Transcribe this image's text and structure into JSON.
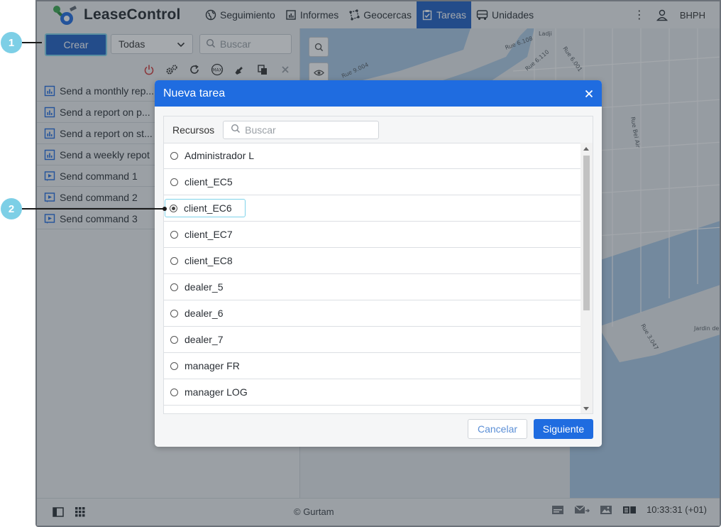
{
  "app": {
    "brand": "LeaseControl",
    "nav": [
      {
        "label": "Seguimiento",
        "icon": "globe-icon"
      },
      {
        "label": "Informes",
        "icon": "report-icon"
      },
      {
        "label": "Geocercas",
        "icon": "geofence-icon"
      },
      {
        "label": "Tareas",
        "icon": "task-icon",
        "active": true
      },
      {
        "label": "Unidades",
        "icon": "bus-icon"
      }
    ],
    "more_label": "⋮",
    "user": "BHPH",
    "accent": "#1f5fc3"
  },
  "left": {
    "create_label": "Crear",
    "filter_value": "Todas",
    "search_placeholder": "Buscar",
    "toolbar_icons": [
      "power-icon",
      "gears-icon",
      "refresh-icon",
      "max-icon",
      "wrench-icon",
      "copy-icon",
      "close-icon"
    ],
    "tasks": [
      {
        "label": "Send a monthly rep...",
        "icon": "report-icon"
      },
      {
        "label": "Send a report on p...",
        "icon": "report-icon"
      },
      {
        "label": "Send a report on st...",
        "icon": "report-icon"
      },
      {
        "label": "Send a weekly repot",
        "icon": "report-icon"
      },
      {
        "label": "Send command 1",
        "icon": "command-icon"
      },
      {
        "label": "Send command 2",
        "icon": "command-icon"
      },
      {
        "label": "Send command 3",
        "icon": "command-icon"
      }
    ]
  },
  "map": {
    "labels": [
      "Ladji",
      "Rue 6.108",
      "Rue 6.001",
      "Rue 6.110",
      "Rue 9.004",
      "Rue Bel Air",
      "Rue 3.047",
      "Jardin de"
    ]
  },
  "modal": {
    "title": "Nueva tarea",
    "resources_label": "Recursos",
    "search_placeholder": "Buscar",
    "resources": [
      {
        "label": "Administrador L",
        "selected": false
      },
      {
        "label": "client_EC5",
        "selected": false
      },
      {
        "label": "client_EC6",
        "selected": true
      },
      {
        "label": "client_EC7",
        "selected": false
      },
      {
        "label": "client_EC8",
        "selected": false
      },
      {
        "label": "dealer_5",
        "selected": false
      },
      {
        "label": "dealer_6",
        "selected": false
      },
      {
        "label": "dealer_7",
        "selected": false
      },
      {
        "label": "manager FR",
        "selected": false
      },
      {
        "label": "manager LOG",
        "selected": false
      }
    ],
    "cancel_label": "Cancelar",
    "next_label": "Siguiente"
  },
  "footer": {
    "copyright": "© Gurtam",
    "time": "10:33:31 (+01)"
  },
  "callouts": [
    "1",
    "2"
  ]
}
